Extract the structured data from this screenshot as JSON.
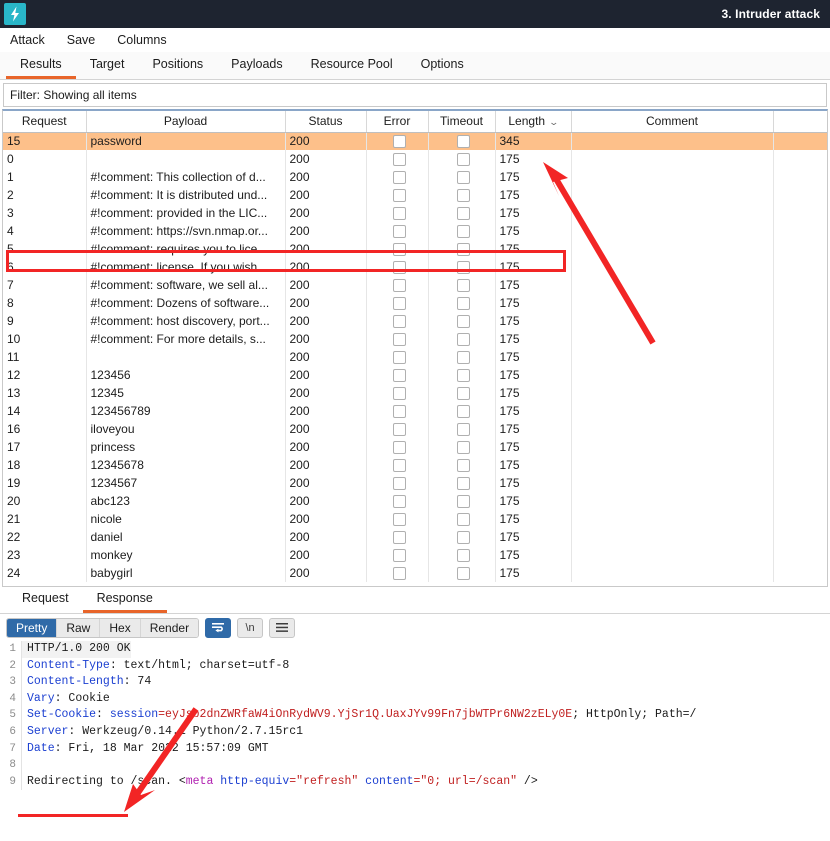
{
  "window": {
    "title": "3. Intruder attack",
    "logo_icon": "burp-lightning-icon"
  },
  "menubar": {
    "items": [
      {
        "label": "Attack"
      },
      {
        "label": "Save"
      },
      {
        "label": "Columns"
      }
    ]
  },
  "tabs": {
    "items": [
      {
        "label": "Results",
        "active": true
      },
      {
        "label": "Target",
        "active": false
      },
      {
        "label": "Positions",
        "active": false
      },
      {
        "label": "Payloads",
        "active": false
      },
      {
        "label": "Resource Pool",
        "active": false
      },
      {
        "label": "Options",
        "active": false
      }
    ]
  },
  "filter": {
    "text": "Filter: Showing all items"
  },
  "results_table": {
    "columns": [
      "Request",
      "Payload",
      "Status",
      "Error",
      "Timeout",
      "Length",
      "Comment"
    ],
    "sorted_column": "Length",
    "sort_caret": "⌄",
    "rows": [
      {
        "request": "15",
        "payload": "password",
        "status": "200",
        "length": "345",
        "comment": "",
        "highlight": true
      },
      {
        "request": "0",
        "payload": "",
        "status": "200",
        "length": "175",
        "comment": "",
        "highlight": false
      },
      {
        "request": "1",
        "payload": "#!comment: This collection of d...",
        "status": "200",
        "length": "175",
        "comment": "",
        "highlight": false
      },
      {
        "request": "2",
        "payload": "#!comment: It is distributed und...",
        "status": "200",
        "length": "175",
        "comment": "",
        "highlight": false
      },
      {
        "request": "3",
        "payload": "#!comment: provided in the LIC...",
        "status": "200",
        "length": "175",
        "comment": "",
        "highlight": false
      },
      {
        "request": "4",
        "payload": "#!comment: https://svn.nmap.or...",
        "status": "200",
        "length": "175",
        "comment": "",
        "highlight": false
      },
      {
        "request": "5",
        "payload": "#!comment: requires you to lice...",
        "status": "200",
        "length": "175",
        "comment": "",
        "highlight": false
      },
      {
        "request": "6",
        "payload": "#!comment: license.  If you wish ...",
        "status": "200",
        "length": "175",
        "comment": "",
        "highlight": false
      },
      {
        "request": "7",
        "payload": "#!comment: software, we sell al...",
        "status": "200",
        "length": "175",
        "comment": "",
        "highlight": false
      },
      {
        "request": "8",
        "payload": "#!comment: Dozens of software...",
        "status": "200",
        "length": "175",
        "comment": "",
        "highlight": false
      },
      {
        "request": "9",
        "payload": "#!comment: host discovery, port...",
        "status": "200",
        "length": "175",
        "comment": "",
        "highlight": false
      },
      {
        "request": "10",
        "payload": "#!comment: For more details, s...",
        "status": "200",
        "length": "175",
        "comment": "",
        "highlight": false
      },
      {
        "request": "11",
        "payload": "",
        "status": "200",
        "length": "175",
        "comment": "",
        "highlight": false
      },
      {
        "request": "12",
        "payload": "123456",
        "status": "200",
        "length": "175",
        "comment": "",
        "highlight": false
      },
      {
        "request": "13",
        "payload": "12345",
        "status": "200",
        "length": "175",
        "comment": "",
        "highlight": false
      },
      {
        "request": "14",
        "payload": "123456789",
        "status": "200",
        "length": "175",
        "comment": "",
        "highlight": false
      },
      {
        "request": "16",
        "payload": "iloveyou",
        "status": "200",
        "length": "175",
        "comment": "",
        "highlight": false
      },
      {
        "request": "17",
        "payload": "princess",
        "status": "200",
        "length": "175",
        "comment": "",
        "highlight": false
      },
      {
        "request": "18",
        "payload": "12345678",
        "status": "200",
        "length": "175",
        "comment": "",
        "highlight": false
      },
      {
        "request": "19",
        "payload": "1234567",
        "status": "200",
        "length": "175",
        "comment": "",
        "highlight": false
      },
      {
        "request": "20",
        "payload": "abc123",
        "status": "200",
        "length": "175",
        "comment": "",
        "highlight": false
      },
      {
        "request": "21",
        "payload": "nicole",
        "status": "200",
        "length": "175",
        "comment": "",
        "highlight": false
      },
      {
        "request": "22",
        "payload": "daniel",
        "status": "200",
        "length": "175",
        "comment": "",
        "highlight": false
      },
      {
        "request": "23",
        "payload": "monkey",
        "status": "200",
        "length": "175",
        "comment": "",
        "highlight": false
      },
      {
        "request": "24",
        "payload": "babygirl",
        "status": "200",
        "length": "175",
        "comment": "",
        "highlight": false
      }
    ]
  },
  "message_tabs": {
    "items": [
      {
        "label": "Request",
        "active": false
      },
      {
        "label": "Response",
        "active": true
      }
    ]
  },
  "viewer_toolbar": {
    "modes": [
      {
        "label": "Pretty",
        "active": true
      },
      {
        "label": "Raw",
        "active": false
      },
      {
        "label": "Hex",
        "active": false
      },
      {
        "label": "Render",
        "active": false
      }
    ],
    "wrap_icon": "word-wrap-icon",
    "newline_label": "\\n",
    "menu_icon": "hamburger-menu-icon"
  },
  "response": {
    "lines": [
      {
        "n": "1",
        "text": "HTTP/1.0 200 OK"
      },
      {
        "n": "2",
        "key": "Content-Type",
        "value": ": text/html; charset=utf-8"
      },
      {
        "n": "3",
        "key": "Content-Length",
        "value": ": 74"
      },
      {
        "n": "4",
        "key": "Vary",
        "value": ": Cookie"
      },
      {
        "n": "5",
        "key": "Set-Cookie",
        "cookie_name": "session",
        "cookie_value": "eyJsb2dnZWRfaW4iOnRydWV9.YjSr1Q.UaxJYv99Fn7jbWTPr6NW2zELy0E",
        "cookie_flags": "; HttpOnly; Path=/"
      },
      {
        "n": "6",
        "key": "Server",
        "value": ": Werkzeug/0.14.1 Python/2.7.15rc1"
      },
      {
        "n": "7",
        "key": "Date",
        "value": ": Fri, 18 Mar 2022 15:57:09 GMT"
      },
      {
        "n": "8",
        "text": ""
      },
      {
        "n": "9",
        "body_prefix": "Redirecting to /scan. <",
        "tag": "meta",
        "attr1": " http-equiv",
        "val1": "=\"refresh\"",
        "attr2": " content",
        "val2": "=\"0; url=/scan\"",
        "suffix": " />"
      }
    ]
  },
  "annotations": {
    "highlight_rect_color": "#f22525",
    "arrow_color": "#f22525",
    "row_highlight_color": "#fdc08a",
    "accent_color": "#e8652a"
  }
}
